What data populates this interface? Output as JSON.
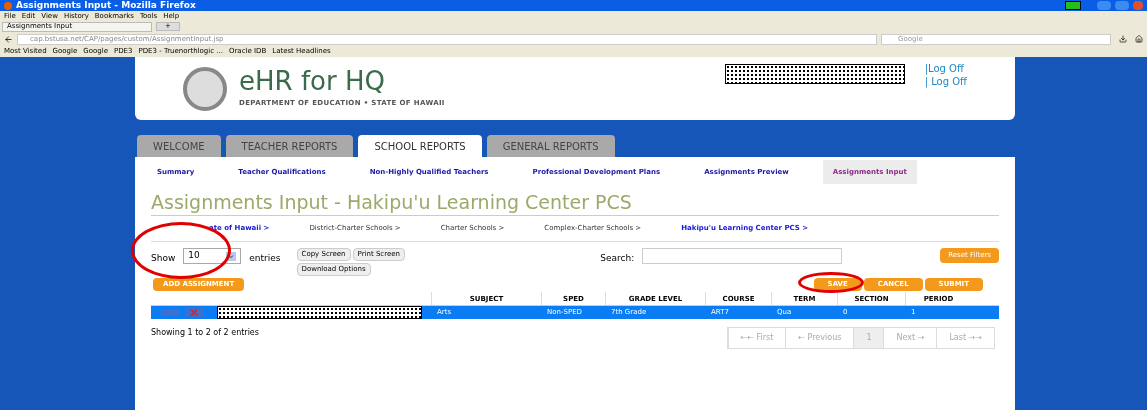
{
  "window": {
    "title": "Assignments Input - Mozilla Firefox"
  },
  "menu": [
    "File",
    "Edit",
    "View",
    "History",
    "Bookmarks",
    "Tools",
    "Help"
  ],
  "browser_tab": {
    "label": "Assignments Input",
    "new_tab": "+"
  },
  "address": {
    "url": "cap.bstusa.net/CAP/pages/custom/AssignmentInput.jsp",
    "search_placeholder": "Google"
  },
  "bookmarks": [
    "Most Visited",
    "Google",
    "Google",
    "PDE3",
    "PDE3 - Truenorthlogic ...",
    "Oracle IDB",
    "Latest Headlines"
  ],
  "header": {
    "app_name": "eHR for HQ",
    "subtitle": "DEPARTMENT OF EDUCATION • STATE OF HAWAII",
    "links": [
      "|Log Off",
      "| Log Off"
    ]
  },
  "main_tabs": [
    {
      "label": "WELCOME",
      "selected": false
    },
    {
      "label": "TEACHER REPORTS",
      "selected": false
    },
    {
      "label": "SCHOOL REPORTS",
      "selected": true
    },
    {
      "label": "GENERAL REPORTS",
      "selected": false
    }
  ],
  "sub_tabs": [
    {
      "label": "Summary",
      "selected": false
    },
    {
      "label": "Teacher Qualifications",
      "selected": false
    },
    {
      "label": "Non-Highly Qualified Teachers",
      "selected": false
    },
    {
      "label": "Professional Development Plans",
      "selected": false
    },
    {
      "label": "Assignments Preview",
      "selected": false
    },
    {
      "label": "Assignments Input",
      "selected": true
    }
  ],
  "page_title": "Assignments Input - Hakipu'u Learning Center PCS",
  "breadcrumbs": [
    {
      "label": "ate of Hawaii >",
      "bold": true
    },
    {
      "label": "District-Charter Schools >",
      "bold": false
    },
    {
      "label": "Charter Schools >",
      "bold": false
    },
    {
      "label": "Complex-Charter Schools >",
      "bold": false
    },
    {
      "label": "Hakipu'u Learning Center PCS >",
      "bold": true
    }
  ],
  "controls": {
    "show_label": "Show",
    "entries_value": "10",
    "entries_label": "entries",
    "buttons": [
      "Copy Screen",
      "Print Screen",
      "Download Options"
    ],
    "search_label": "Search:",
    "reset": "Reset Filters"
  },
  "actions": {
    "add": "ADD ASSIGNMENT",
    "save": "SAVE",
    "cancel": "CANCEL",
    "submit": "SUBMIT"
  },
  "table": {
    "columns": [
      "SUBJECT",
      "SPED",
      "GRADE LEVEL",
      "COURSE",
      "TERM",
      "SECTION",
      "PERIOD"
    ],
    "rows": [
      {
        "selected": true,
        "cells": [
          "Arts",
          "Non-SPED",
          "7th Grade",
          "ART7",
          "Qua",
          "0",
          "1"
        ]
      }
    ]
  },
  "info": "Showing 1 to 2 of 2 entries",
  "pagination": [
    {
      "label": "←← First",
      "selected": false
    },
    {
      "label": "← Previous",
      "selected": false
    },
    {
      "label": "1",
      "selected": true
    },
    {
      "label": "Next →",
      "selected": false
    },
    {
      "label": "Last →→",
      "selected": false
    }
  ]
}
